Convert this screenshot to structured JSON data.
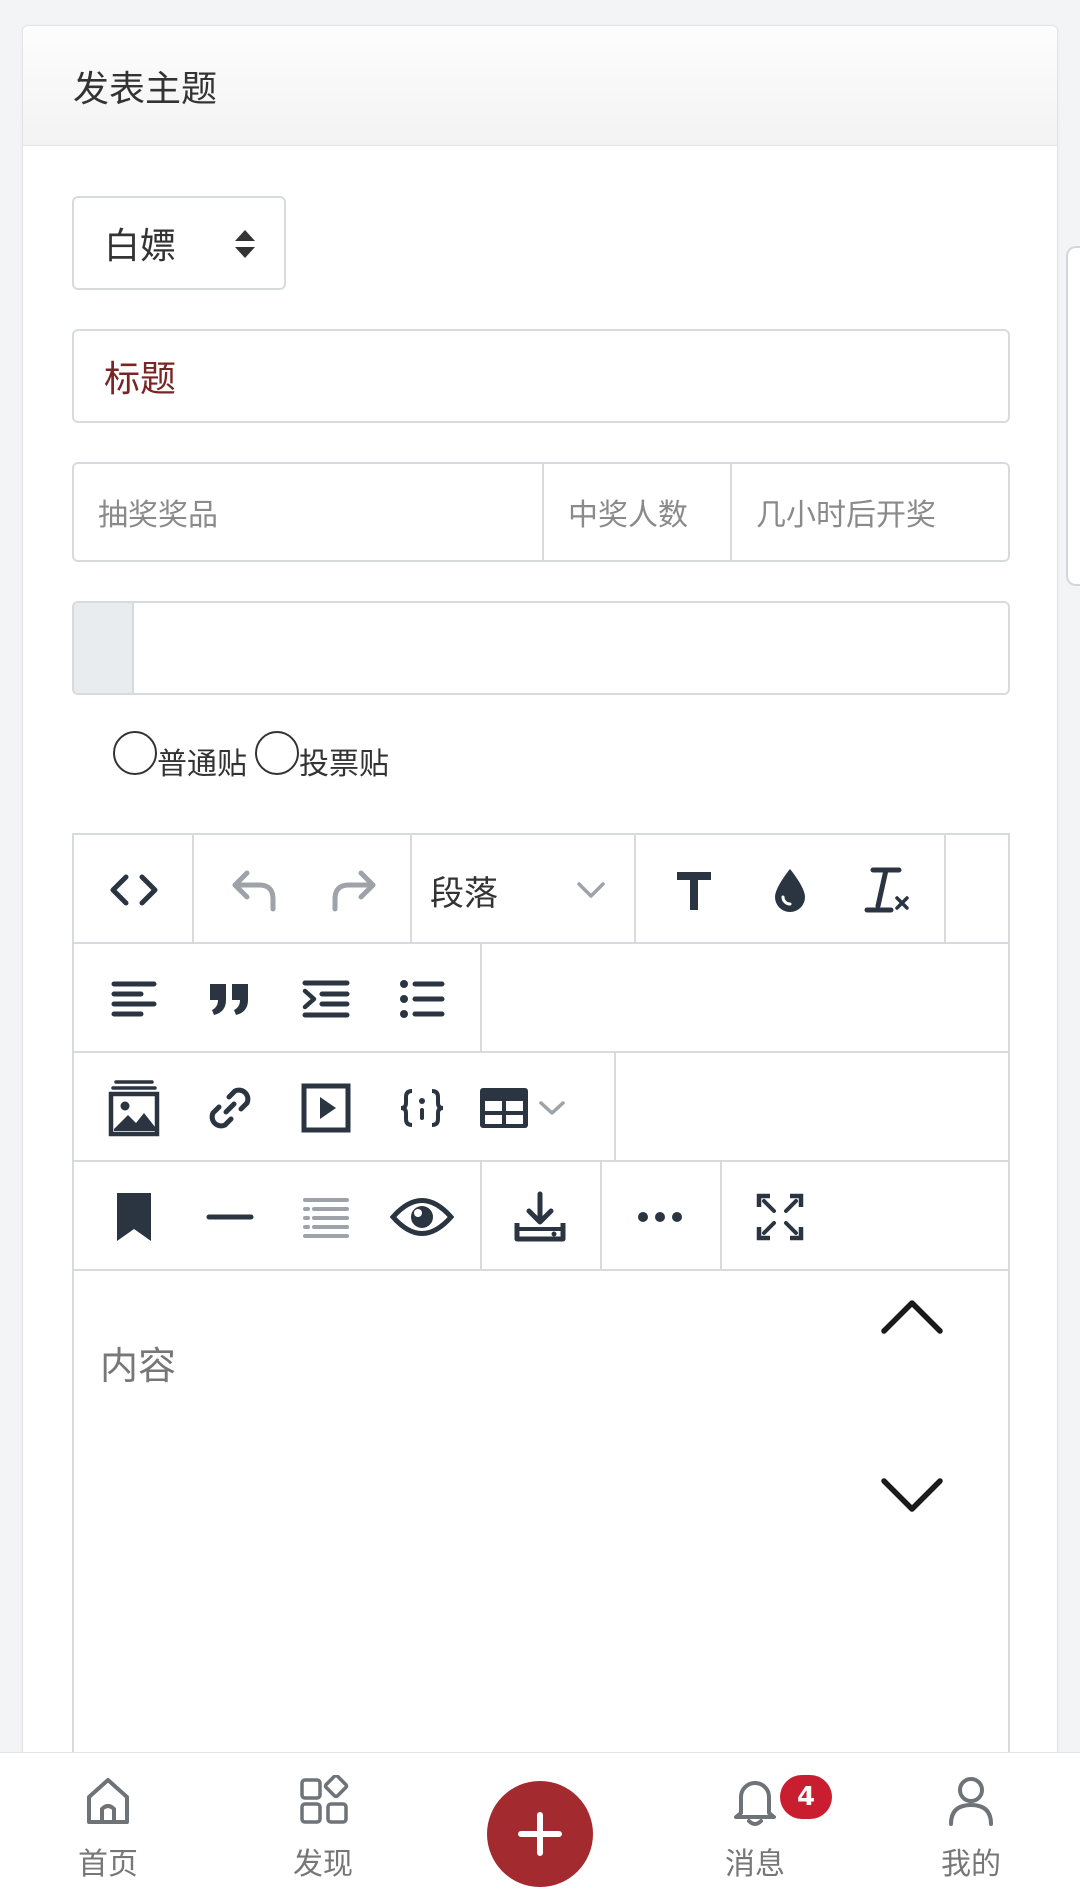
{
  "header": {
    "title": "发表主题"
  },
  "category_select": {
    "value": "白嫖"
  },
  "title_field": {
    "placeholder": "标题"
  },
  "lottery": {
    "prize_placeholder": "抽奖奖品",
    "winners_placeholder": "中奖人数",
    "hours_placeholder": "几小时后开奖"
  },
  "post_type": {
    "options": [
      "普通贴",
      "投票贴"
    ]
  },
  "editor": {
    "block_format": "段落",
    "content_placeholder": "内容",
    "toolbar_icons": [
      "code-view-icon",
      "undo-icon",
      "redo-icon",
      "paragraph-dropdown",
      "text-style-icon",
      "color-drop-icon",
      "clear-format-icon",
      "align-left-icon",
      "blockquote-icon",
      "indent-icon",
      "bullet-list-icon",
      "image-icon",
      "link-icon",
      "video-icon",
      "code-block-icon",
      "table-icon",
      "bookmark-icon",
      "horizontal-rule-icon",
      "toc-icon",
      "preview-icon",
      "download-icon",
      "more-icon",
      "fullscreen-icon"
    ]
  },
  "bottom_nav": {
    "items": [
      {
        "label": "首页",
        "icon": "home-icon"
      },
      {
        "label": "发现",
        "icon": "discover-icon"
      },
      {
        "label": "消息",
        "icon": "bell-icon"
      },
      {
        "label": "我的",
        "icon": "user-icon"
      }
    ],
    "new_post_icon": "plus-icon",
    "messages_badge": "4"
  },
  "colors": {
    "accent": "#a32a2e",
    "badge": "#c81e2f",
    "icon_dark": "#2b3542",
    "border": "#d8dbde"
  }
}
